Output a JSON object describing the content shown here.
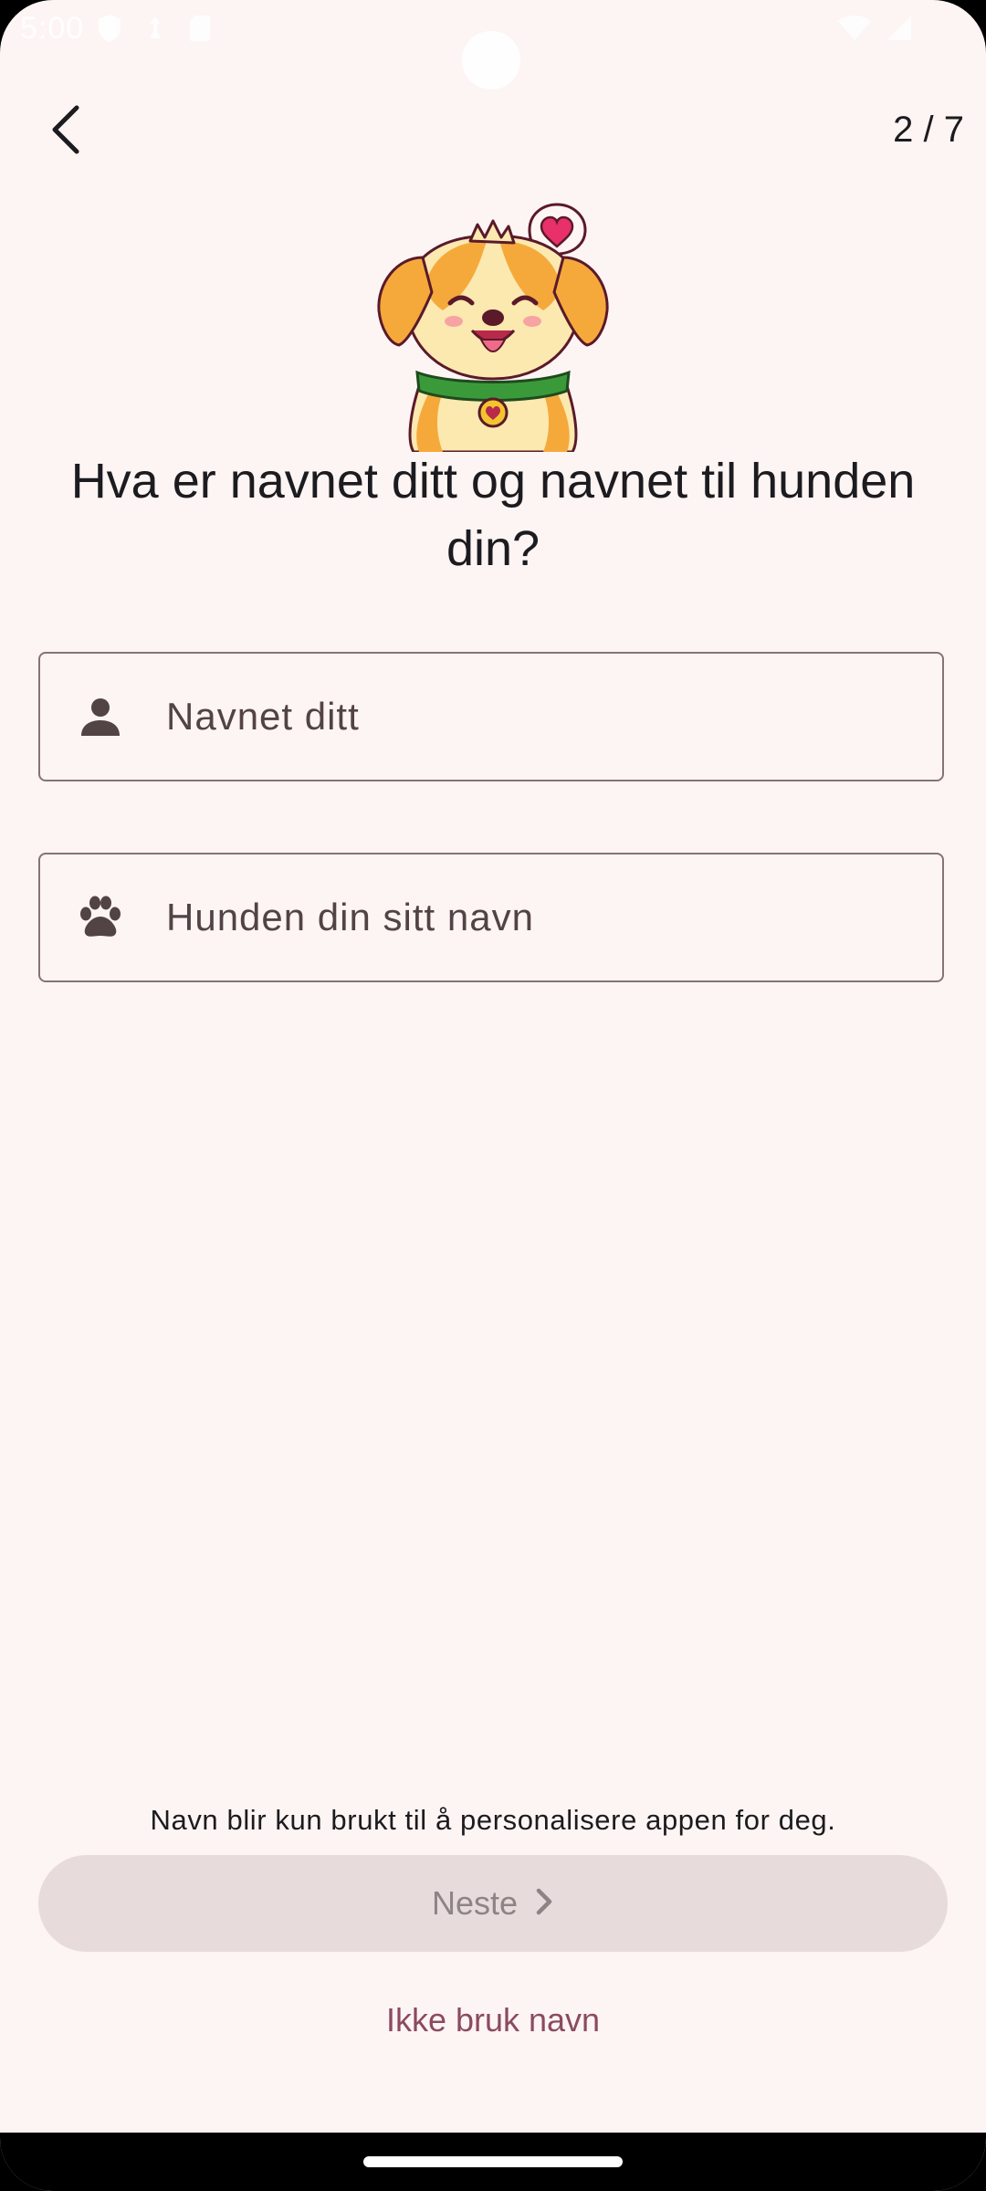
{
  "status_bar": {
    "time": "5:00",
    "icons": [
      "shield-icon",
      "signal-sim-icon",
      "sd-card-icon",
      "wifi-icon",
      "cell-signal-icon"
    ]
  },
  "header": {
    "back_icon": "arrow-back-icon",
    "step": "2 / 7"
  },
  "headline": "Hva er navnet ditt og navnet til hunden din?",
  "fields": {
    "owner_name": {
      "icon": "person-icon",
      "placeholder": "Navnet ditt",
      "value": ""
    },
    "dog_name": {
      "icon": "paw-icon",
      "placeholder": "Hunden din sitt navn",
      "value": ""
    }
  },
  "footer": {
    "helper_text": "Navn blir kun brukt til å personalisere appen for deg.",
    "next_label": "Neste",
    "next_enabled": false,
    "skip_label": "Ikke bruk navn"
  },
  "colors": {
    "background": "#fdf5f3",
    "outline": "#877373",
    "button_disabled": "#e7dcdb",
    "link": "#8b4a62",
    "dog_fur": "#f6a93b",
    "collar": "#3a9a3a",
    "heart": "#e8306a"
  }
}
